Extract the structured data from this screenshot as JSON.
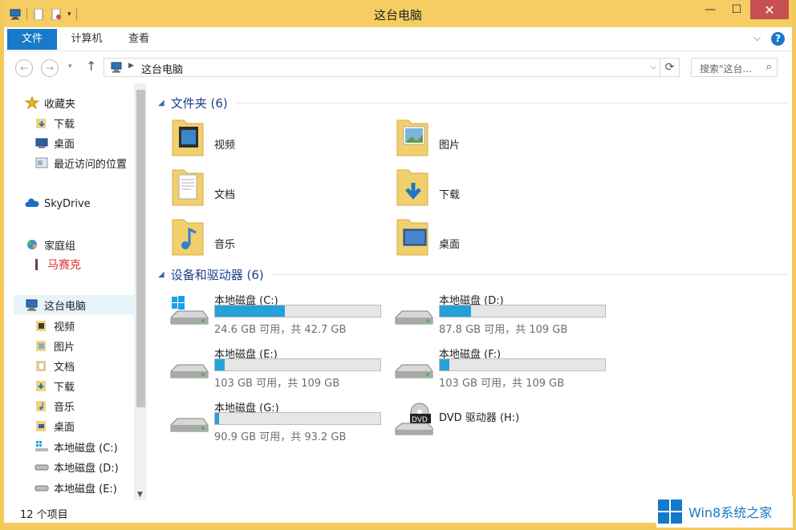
{
  "window": {
    "title": "这台电脑",
    "close_glyph": "✕",
    "min_glyph": "—",
    "max_glyph": "☐"
  },
  "ribbon": {
    "tabs": [
      "文件",
      "计算机",
      "查看"
    ],
    "help": "?"
  },
  "address": {
    "path": "这台电脑",
    "search_placeholder": "搜索\"这台..."
  },
  "nav": {
    "favorites": "收藏夹",
    "fav_items": [
      "下载",
      "桌面",
      "最近访问的位置"
    ],
    "skydrive": "SkyDrive",
    "homegroup": "家庭组",
    "homegroup_user": "马赛克",
    "this_pc": "这台电脑",
    "pc_items": [
      "视频",
      "图片",
      "文档",
      "下载",
      "音乐",
      "桌面",
      "本地磁盘 (C:)",
      "本地磁盘 (D:)",
      "本地磁盘 (E:)"
    ]
  },
  "folders_group": "文件夹 (6)",
  "folders": [
    "视频",
    "图片",
    "文档",
    "下载",
    "音乐",
    "桌面"
  ],
  "devices_group": "设备和驱动器 (6)",
  "drives": [
    {
      "name": "本地磁盘 (C:)",
      "free": "24.6 GB 可用，共 42.7 GB",
      "used_fraction": 0.42
    },
    {
      "name": "本地磁盘 (D:)",
      "free": "87.8 GB 可用，共 109 GB",
      "used_fraction": 0.19
    },
    {
      "name": "本地磁盘 (E:)",
      "free": "103 GB 可用，共 109 GB",
      "used_fraction": 0.06
    },
    {
      "name": "本地磁盘 (F:)",
      "free": "103 GB 可用，共 109 GB",
      "used_fraction": 0.06
    },
    {
      "name": "本地磁盘 (G:)",
      "free": "90.9 GB 可用，共 93.2 GB",
      "used_fraction": 0.025
    }
  ],
  "dvd": {
    "name": "DVD 驱动器 (H:)",
    "badge": "DVD"
  },
  "status": {
    "items": "12 个项目"
  },
  "watermark": {
    "text": "Win8系统之家"
  },
  "colors": {
    "accent": "#1979ca",
    "bar_fill": "#26a0da",
    "frame": "#f5cd63",
    "group_title": "#1e3f8a"
  }
}
